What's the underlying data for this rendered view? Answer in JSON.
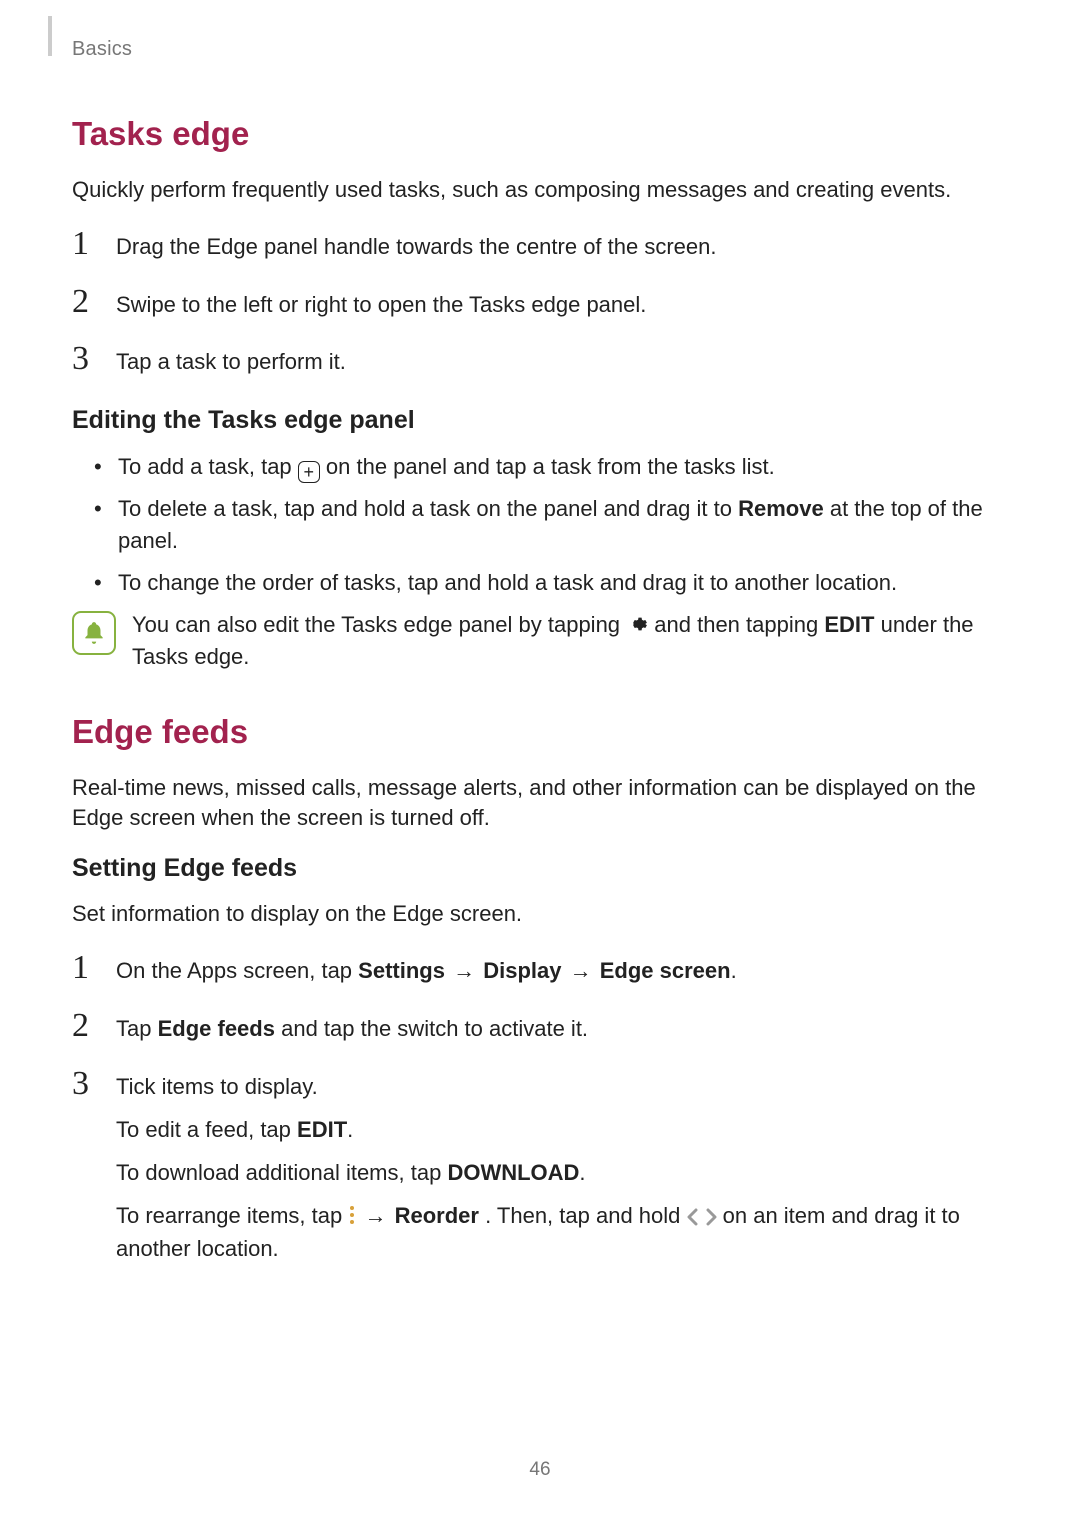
{
  "breadcrumb": "Basics",
  "page_number": "46",
  "tasks_edge": {
    "title": "Tasks edge",
    "intro": "Quickly perform frequently used tasks, such as composing messages and creating events.",
    "steps": [
      {
        "n": "1",
        "text": "Drag the Edge panel handle towards the centre of the screen."
      },
      {
        "n": "2",
        "text": "Swipe to the left or right to open the Tasks edge panel."
      },
      {
        "n": "3",
        "text": "Tap a task to perform it."
      }
    ],
    "edit_heading": "Editing the Tasks edge panel",
    "bullets": {
      "add_prefix": "To add a task, tap ",
      "add_suffix": " on the panel and tap a task from the tasks list.",
      "delete_prefix": "To delete a task, tap and hold a task on the panel and drag it to ",
      "delete_bold": "Remove",
      "delete_suffix": " at the top of the panel.",
      "reorder": "To change the order of tasks, tap and hold a task and drag it to another location."
    },
    "note": {
      "prefix": "You can also edit the Tasks edge panel by tapping ",
      "mid": " and then tapping ",
      "edit_label": "EDIT",
      "suffix": " under the Tasks edge."
    }
  },
  "edge_feeds": {
    "title": "Edge feeds",
    "intro": "Real-time news, missed calls, message alerts, and other information can be displayed on the Edge screen when the screen is turned off.",
    "sub_heading": "Setting Edge feeds",
    "sub_intro": "Set information to display on the Edge screen.",
    "steps": {
      "s1": {
        "n": "1",
        "prefix": "On the Apps screen, tap ",
        "p1": "Settings",
        "p2": "Display",
        "p3": "Edge screen",
        "arrow": " → ",
        "period": "."
      },
      "s2": {
        "n": "2",
        "prefix": "Tap ",
        "bold": "Edge feeds",
        "suffix": " and tap the switch to activate it."
      },
      "s3": {
        "n": "3",
        "main": "Tick items to display.",
        "edit_prefix": "To edit a feed, tap ",
        "edit_bold": "EDIT",
        "edit_suffix": ".",
        "dl_prefix": "To download additional items, tap ",
        "dl_bold": "DOWNLOAD",
        "dl_suffix": ".",
        "re_prefix": "To rearrange items, tap ",
        "re_arrow": " → ",
        "re_bold": "Reorder",
        "re_mid": ". Then, tap and hold ",
        "re_suffix": " on an item and drag it to another location."
      }
    }
  }
}
